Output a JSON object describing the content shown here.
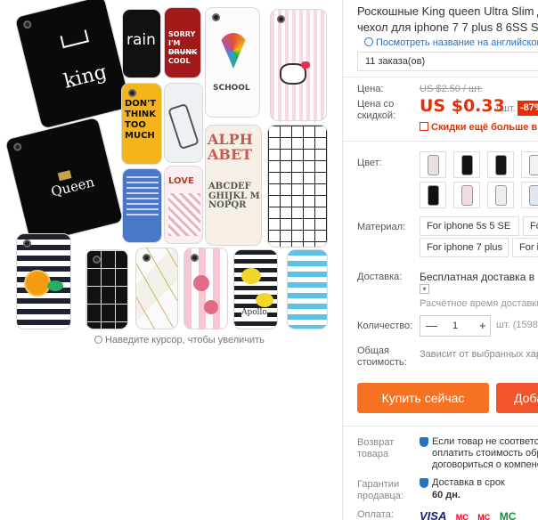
{
  "gallery": {
    "zoom_hint": "Наведите курсор, чтобы увеличить",
    "case_texts": {
      "king": "king",
      "rain": "rain",
      "sorry1": "SORRY",
      "sorry2": "I'M",
      "sorry3": "DRUNK",
      "sorry4": "COOL",
      "dont1": "DON'T",
      "dont2": "THINK",
      "dont3": "TOO",
      "dont4": "MUCH",
      "school": "SCHOOL",
      "queen": "Queen",
      "alphabet": "ALPHABET",
      "abc": "ABCDEF GHIJKL MNOPQR",
      "apollo": "Apollo",
      "love": "LOVE"
    }
  },
  "product": {
    "title_line1": "Роскошные King queen Ultra Slim д",
    "title_line2": "чехол для iphone 7 7 plus 8 6SS SE 6",
    "translate_link": "Посмотреть название на английском",
    "orders": "11 заказа(ов)"
  },
  "price": {
    "label": "Цена:",
    "old": "US $2.50 / шт.",
    "discount_label": "Цена со скидкой:",
    "new": "US $0.33",
    "per_unit": "/ шт.",
    "discount_badge": "-87%",
    "coupon": "Скидки ещё больше в при"
  },
  "color": {
    "label": "Цвет:",
    "swatches": [
      "#e9e0dc",
      "#111111",
      "#161616",
      "#f2f2f2",
      "#101010",
      "#f4d9df",
      "#eeeeee",
      "#dfe8f0"
    ]
  },
  "material": {
    "label": "Материал:",
    "options": [
      "For iphone 5s 5 SE",
      "For i",
      "For iphone 7 plus",
      "For i"
    ]
  },
  "shipping": {
    "label": "Доставка:",
    "value": "Бесплатная доставка в Rus",
    "time": "Расчётное время доставки: 2"
  },
  "quantity": {
    "label": "Количество:",
    "minus": "—",
    "value": "1",
    "plus": "+",
    "note": "шт. (15983"
  },
  "total": {
    "label": "Общая стоимость:",
    "note": "Зависит от выбранных хара"
  },
  "actions": {
    "buy": "Купить сейчас",
    "add": "Доба"
  },
  "protection": {
    "refund_label": "Возврат товара",
    "refund_line1": "Если товар не соответсте",
    "refund_line2": "оплатить стоимость обрат",
    "refund_line3": "договориться о компенса",
    "guarantee_label": "Гарантии продавца:",
    "guarantee_line1": "Доставка в срок",
    "guarantee_line2": "60 дн.",
    "payment_label": "Оплата:",
    "cards": [
      "VISA",
      "MC",
      "MC",
      "MC"
    ]
  },
  "colors": {
    "accent": "#e62e04",
    "buy_button": "#f57224",
    "add_button": "#f2542b",
    "link": "#2473c4"
  }
}
